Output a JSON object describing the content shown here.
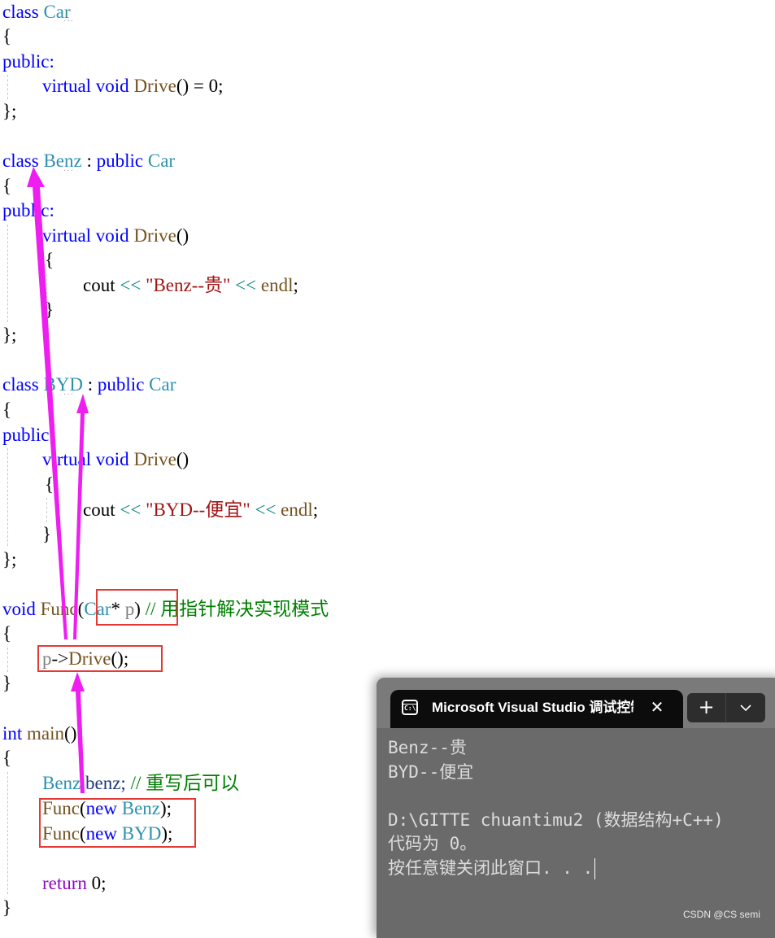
{
  "editor": {
    "lines": {
      "l1": {
        "kw": "class",
        "name": "Car"
      },
      "l2": "{",
      "l3": "public:",
      "l4": {
        "kw1": "virtual",
        "kw2": "void",
        "fn": "Drive",
        "rest": "() = 0;"
      },
      "l5": "};",
      "l7": {
        "kw": "class",
        "name": "Benz",
        "sep": " : ",
        "kw2": "public",
        "base": "Car"
      },
      "l8": "{",
      "l9": "public:",
      "l10": {
        "kw1": "virtual",
        "kw2": "void",
        "fn": "Drive",
        "rest": "()"
      },
      "l11": "{",
      "l12": {
        "id": "cout",
        "op": "<<",
        "str": "\"Benz--贵\"",
        "endl": "endl",
        "end": ";"
      },
      "l13": "}",
      "l14": "};",
      "l16": {
        "kw": "class",
        "name": "BYD",
        "sep": " : ",
        "kw2": "public",
        "base": "Car"
      },
      "l17": "{",
      "l18": "public:",
      "l19": {
        "kw1": "virtual",
        "kw2": "void",
        "fn": "Drive",
        "rest": "()"
      },
      "l20": "{",
      "l21": {
        "id": "cout",
        "op": "<<",
        "str": "\"BYD--便宜\"",
        "endl": "endl",
        "end": ";"
      },
      "l22": "}",
      "l23": "};",
      "l25": {
        "kw": "void",
        "fn": "Func",
        "open": "(",
        "type": "Car",
        "star": "* ",
        "param": "p",
        "close": ")",
        "comment": "// 用指针解决实现模式"
      },
      "l26": "{",
      "l27": {
        "param": "p",
        "arrow": "->",
        "fn": "Drive",
        "rest": "();"
      },
      "l28": "}",
      "l30": {
        "kw": "int",
        "fn": "main",
        "rest": "()"
      },
      "l31": "{",
      "l32": {
        "type": "Benz",
        "var": " benz;",
        "comment": "// 重写后可以"
      },
      "l33": {
        "fn": "Func",
        "open": "(",
        "kw": "new",
        "type": "Benz",
        "close": ");"
      },
      "l34": {
        "fn": "Func",
        "open": "(",
        "kw": "new",
        "type": "BYD",
        "close": ");"
      },
      "l36": {
        "kw": "return",
        "rest": " 0;"
      },
      "l37": "}"
    },
    "squiggle": "···"
  },
  "console": {
    "tab_title": "Microsoft Visual Studio 调试控制台",
    "tab_icon_text": "C:\\",
    "close_glyph": "✕",
    "new_tab_glyph": "+",
    "dropdown_glyph": "⌄",
    "output": [
      "Benz--贵",
      "BYD--便宜",
      "",
      "D:\\GITTE chuantimu2 (数据结构+C++)",
      "代码为 0。",
      "按任意键关闭此窗口. . ."
    ]
  },
  "watermark": "CSDN @CS semi",
  "colors": {
    "annotation_arrow": "#ee1ef0",
    "annotation_box": "#e53935"
  }
}
